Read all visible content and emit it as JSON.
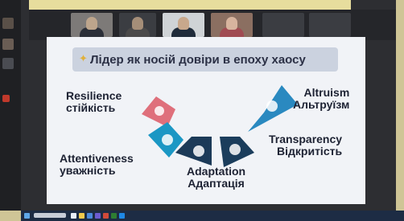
{
  "slide": {
    "title": "Лідер як носій довіри в епоху хаосу",
    "keywords": [
      {
        "en": "Resilience",
        "ua": "стійкість"
      },
      {
        "en": "Attentiveness",
        "ua": "уважність"
      },
      {
        "en": "Adaptation",
        "ua": "Адаптація"
      },
      {
        "en": "Transparency",
        "ua": "Відкритість"
      },
      {
        "en": "Altruism",
        "ua": "Альтруїзм"
      }
    ],
    "segment_colors": [
      "#df6f7b",
      "#1b97c4",
      "#1c3a58",
      "#1b3d5c",
      "#2a89c0"
    ],
    "title_icon": "lightbulb-icon"
  },
  "colors": {
    "taskbar": "#1d2c44",
    "slide_bg": "#f1f3f7",
    "title_box": "#cbd2df"
  }
}
